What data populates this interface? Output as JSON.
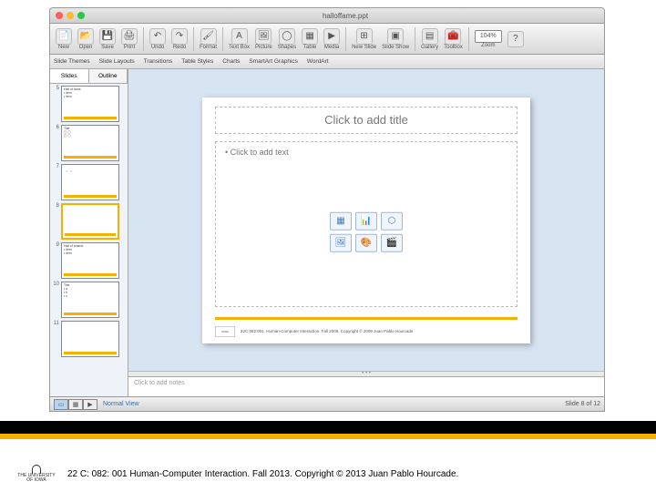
{
  "window": {
    "doc_title": "halloffame.ppt"
  },
  "toolbar": {
    "new": "New",
    "open": "Open",
    "save": "Save",
    "print": "Print",
    "undo": "Undo",
    "redo": "Redo",
    "format": "Format",
    "textbox": "Text Box",
    "picture": "Picture",
    "shapes": "Shapes",
    "table": "Table",
    "media": "Media",
    "newslide": "New Slide",
    "slideshow": "Slide Show",
    "gallery": "Gallery",
    "toolbox": "Toolbox",
    "zoom": "Zoom",
    "zoom_value": "104%"
  },
  "subtoolbar": {
    "slide_themes": "Slide Themes",
    "slide_layouts": "Slide Layouts",
    "transitions": "Transitions",
    "table_styles": "Table Styles",
    "charts": "Charts",
    "smart_graphics": "SmartArt Graphics",
    "wordart": "WordArt"
  },
  "panel": {
    "tab_slides": "Slides",
    "tab_outline": "Outline"
  },
  "thumbs": [
    {
      "num": "5"
    },
    {
      "num": "6"
    },
    {
      "num": "7"
    },
    {
      "num": "8"
    },
    {
      "num": "9"
    },
    {
      "num": "10"
    },
    {
      "num": "11"
    }
  ],
  "slide": {
    "title_ph": "Click to add title",
    "body_ph": "Click to add text",
    "footer_text": "22C:082:001. Human-Computer Interaction. Fall 2009. Copyright © 2009 Juan Pablo Hourcade."
  },
  "notes": {
    "placeholder": "Click to add notes"
  },
  "status": {
    "view_label": "Normal View",
    "slide_counter": "Slide 8 of 12"
  },
  "outer": {
    "caption": "22 C: 082: 001 Human-Computer Interaction. Fall 2013. Copyright © 2013 Juan Pablo Hourcade.",
    "univ1": "THE UNIVERSITY",
    "univ2": "OF IOWA"
  }
}
